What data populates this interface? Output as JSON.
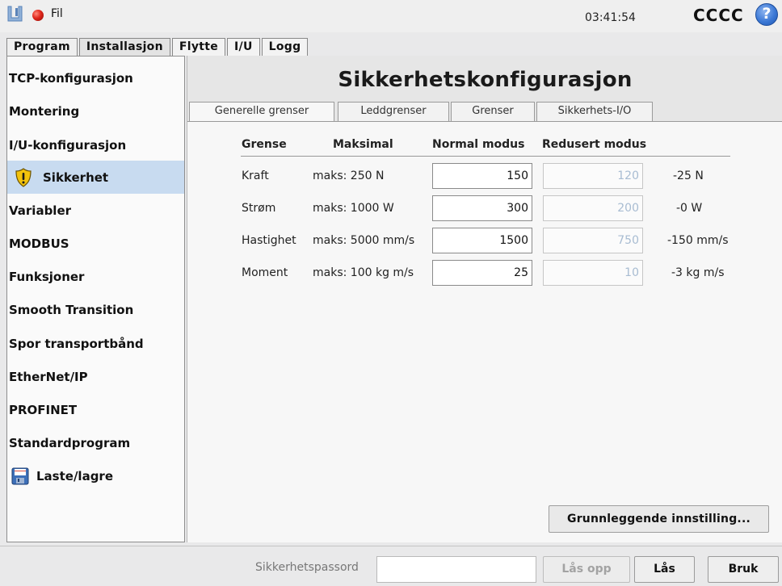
{
  "topbar": {
    "file_menu": "Fil",
    "clock": "03:41:54",
    "robot_name": "CCCC",
    "help_glyph": "?"
  },
  "main_tabs": [
    {
      "label": "Program",
      "active": false
    },
    {
      "label": "Installasjon",
      "active": true
    },
    {
      "label": "Flytte",
      "active": false
    },
    {
      "label": "I/U",
      "active": false
    },
    {
      "label": "Logg",
      "active": false
    }
  ],
  "sidebar": {
    "items": [
      {
        "label": "TCP-konfigurasjon"
      },
      {
        "label": "Montering"
      },
      {
        "label": "I/U-konfigurasjon"
      },
      {
        "label": "Sikkerhet",
        "icon": "warning-shield-icon",
        "active": true
      },
      {
        "label": "Variabler"
      },
      {
        "label": "MODBUS"
      },
      {
        "label": "Funksjoner"
      },
      {
        "label": "Smooth Transition"
      },
      {
        "label": "Spor transportbånd"
      },
      {
        "label": "EtherNet/IP"
      },
      {
        "label": "PROFINET"
      },
      {
        "label": "Standardprogram"
      },
      {
        "label": "Laste/lagre",
        "icon": "floppy-disk-icon"
      }
    ]
  },
  "content": {
    "title": "Sikkerhetskonfigurasjon",
    "sub_tabs": [
      {
        "label": "Generelle grenser",
        "active": true
      },
      {
        "label": "Leddgrenser"
      },
      {
        "label": "Grenser"
      },
      {
        "label": "Sikkerhets-I/O"
      }
    ],
    "columns": {
      "limit": "Grense",
      "max": "Maksimal",
      "normal": "Normal modus",
      "reduced": "Redusert modus"
    },
    "rows": [
      {
        "label": "Kraft",
        "max": "maks: 250 N",
        "normal": "150",
        "reduced": "120",
        "diff": "-25 N"
      },
      {
        "label": "Strøm",
        "max": "maks: 1000 W",
        "normal": "300",
        "reduced": "200",
        "diff": "-0 W"
      },
      {
        "label": "Hastighet",
        "max": "maks: 5000 mm/s",
        "normal": "1500",
        "reduced": "750",
        "diff": "-150 mm/s"
      },
      {
        "label": "Moment",
        "max": "maks: 100 kg m/s",
        "normal": "25",
        "reduced": "10",
        "diff": "-3 kg m/s"
      }
    ],
    "basic_button": "Grunnleggende innstilling..."
  },
  "bottombar": {
    "password_label": "Sikkerhetspassord",
    "password_value": "",
    "unlock_button": "Lås opp",
    "lock_button": "Lås",
    "apply_button": "Bruk"
  },
  "colors": {
    "accent_selection": "#c8dbf0",
    "record_dot": "#e0261b",
    "help_blue": "#3c79d6",
    "warning_yellow": "#f2c20c"
  }
}
